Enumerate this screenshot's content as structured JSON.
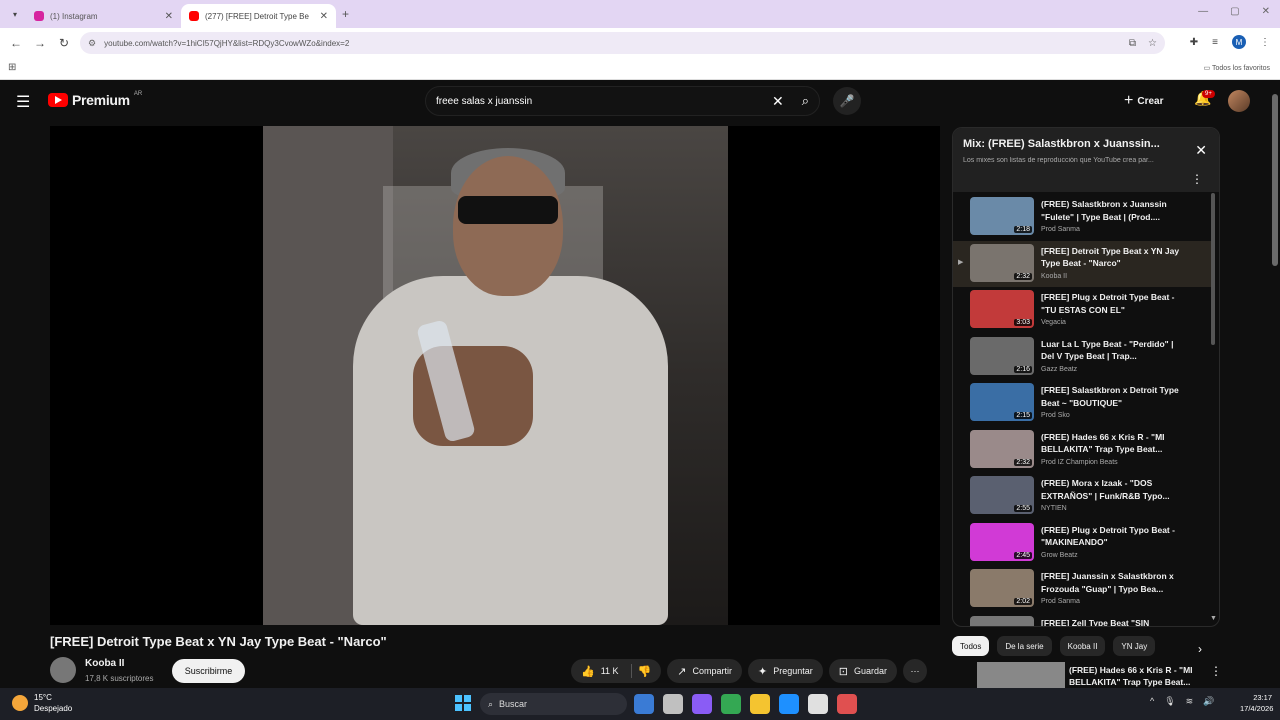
{
  "browser": {
    "tabs": [
      {
        "title": "(1) Instagram",
        "active": false,
        "fav_color": "#d6249f"
      },
      {
        "title": "(277) [FREE] Detroit Type Be",
        "active": true,
        "fav_color": "#ff0000"
      }
    ],
    "url": "youtube.com/watch?v=1hiCI57QjHY&list=RDQy3CvowWZo&index=2",
    "bookmarks_all": "Todos los favoritos",
    "profile_initial": "M"
  },
  "yt": {
    "logo_text": "Premium",
    "logo_region": "AR",
    "search_query": "freee salas x juanssin",
    "create_label": "Crear",
    "notif_badge": "9+"
  },
  "video": {
    "title": "[FREE] Detroit Type Beat x YN Jay Type Beat - \"Narco\"",
    "channel": "Kooba II",
    "subscribers": "17,8 K suscriptores",
    "subscribe_label": "Suscribirme",
    "likes": "11 K",
    "share_label": "Compartir",
    "ask_label": "Preguntar",
    "save_label": "Guardar"
  },
  "playlist": {
    "title": "Mix: (FREE) Salastkbron x Juanssin...",
    "subtitle": "Los mixes son listas de reproducción que YouTube crea par...",
    "items": [
      {
        "title": "(FREE) Salastkbron x Juanssin \"Fulete\" | Type Beat | (Prod....",
        "channel": "Prod Sanma",
        "duration": "2:18",
        "thumb": "#6a8aa8",
        "current": false
      },
      {
        "title": "[FREE] Detroit Type Beat x YN Jay Type Beat - \"Narco\"",
        "channel": "Kooba II",
        "duration": "2:32",
        "thumb": "#7a746e",
        "current": true
      },
      {
        "title": "[FREE] Plug x Detroit Type Beat - \"TU ESTAS CON EL\"",
        "channel": "Vegacia",
        "duration": "3:03",
        "thumb": "#c23a3a",
        "current": false
      },
      {
        "title": "Luar La L Type Beat - \"Perdido\" | Del V Type Beat | Trap...",
        "channel": "Gazz Beatz",
        "duration": "2:16",
        "thumb": "#6a6a6a",
        "current": false
      },
      {
        "title": "[FREE] Salastkbron x Detroit Type Beat ~ \"BOUTIQUE\"",
        "channel": "Prod Sko",
        "duration": "2:15",
        "thumb": "#3a6ea5",
        "current": false
      },
      {
        "title": "(FREE) Hades 66 x Kris R - \"MI BELLAKITA\" Trap Type Beat...",
        "channel": "Prod IZ Champion Beats",
        "duration": "2:32",
        "thumb": "#9a8a8a",
        "current": false
      },
      {
        "title": "(FREE) Mora x Izaak - \"DOS EXTRAÑOS\" | Funk/R&B Typo...",
        "channel": "NYTIEN",
        "duration": "2:55",
        "thumb": "#5a6070",
        "current": false
      },
      {
        "title": "(FREE) Plug x Detroit Typo Beat - \"MAKINEANDO\"",
        "channel": "Grow Beatz",
        "duration": "2:45",
        "thumb": "#d13ad6",
        "current": false
      },
      {
        "title": "[FREE] Juanssin x Salastkbron x Frozouda \"Guap\" | Typo Bea...",
        "channel": "Prod Sanma",
        "duration": "2:02",
        "thumb": "#8a7a6a",
        "current": false
      },
      {
        "title": "[FREE] Zell Type Beat \"SIN",
        "channel": "",
        "duration": "",
        "thumb": "#777777",
        "current": false
      }
    ]
  },
  "chips": [
    "Todos",
    "De la serie",
    "Kooba II",
    "YN Jay"
  ],
  "recommendation": {
    "title": "(FREE) Hades 66 x Kris R - \"MI BELLAKITA\" Trap Type Beat..."
  },
  "taskbar": {
    "temp": "15°C",
    "weather": "Despejado",
    "search_label": "Buscar",
    "time": "23:17",
    "date": "17/4/2026",
    "apps": [
      "#3a7bd5",
      "#c0c0c0",
      "#8a5cf5",
      "#34a853",
      "#f4c430",
      "#1e90ff",
      "#e0e0e0",
      "#e05050"
    ]
  }
}
